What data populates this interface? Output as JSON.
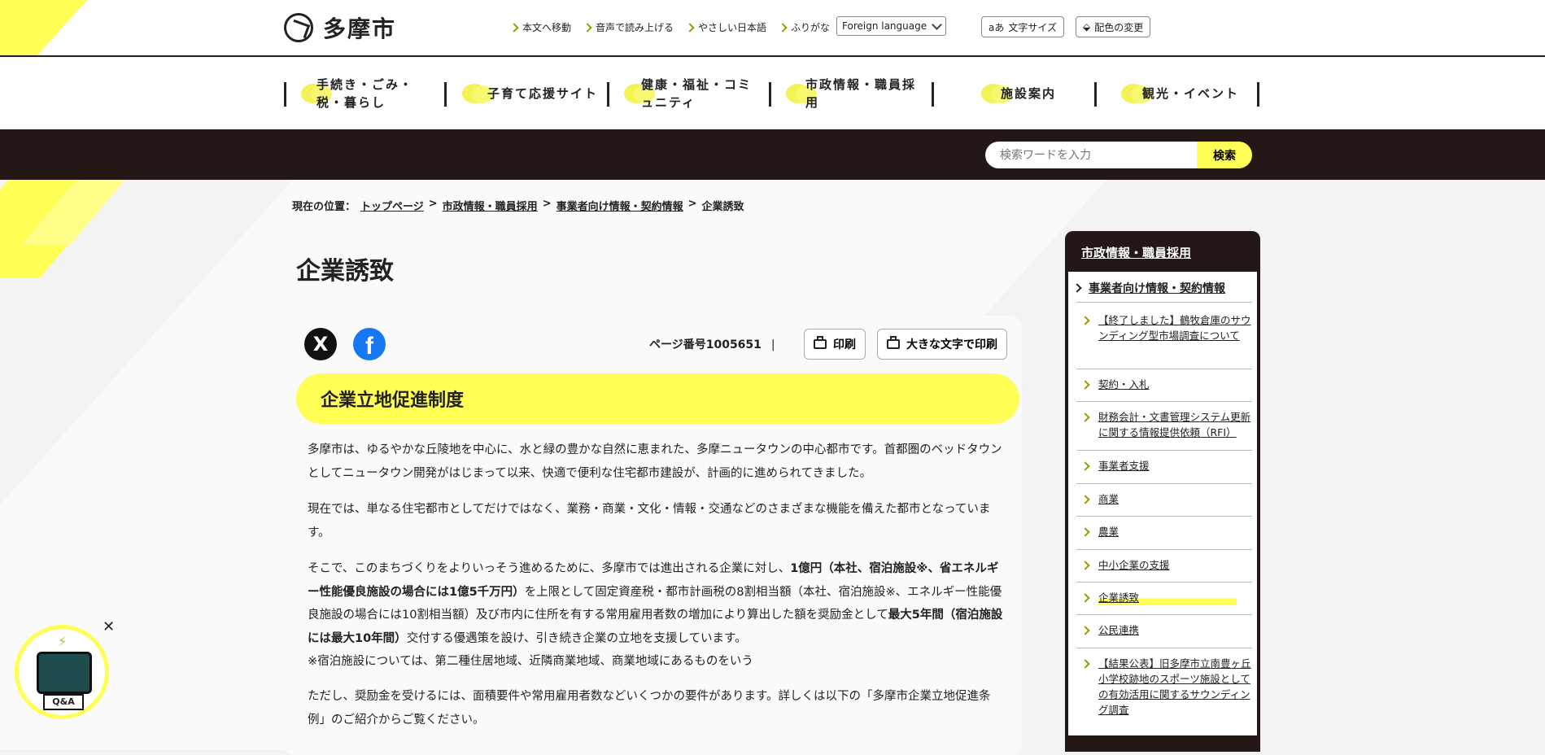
{
  "header": {
    "logo_text": "多摩市",
    "util_links": [
      "本文へ移動",
      "音声で読み上げる",
      "やさしい日本語",
      "ふりがな"
    ],
    "language_select": "Foreign language",
    "font_size_label": "文字サイズ",
    "font_size_icon_text": "aあ",
    "color_change_label": "配色の変更"
  },
  "gnav": {
    "items": [
      "手続き・ごみ・税・暮らし",
      "子育て応援サイト",
      "健康・福祉・コミュニティ",
      "市政情報・職員採用",
      "施設案内",
      "観光・イベント"
    ]
  },
  "search": {
    "placeholder": "検索ワードを入力",
    "button": "検索"
  },
  "breadcrumb": {
    "label": "現在の位置：",
    "links": [
      "トップページ",
      "市政情報・職員採用",
      "事業者向け情報・契約情報"
    ],
    "separator": ">",
    "current": "企業誘致"
  },
  "page": {
    "title": "企業誘致",
    "sns_x": "X",
    "sns_fb": "f",
    "page_number": "ページ番号1005651",
    "page_number_sep": "|",
    "print_label": "印刷",
    "print_large_label": "大きな文字で印刷",
    "section_heading": "企業立地促進制度",
    "para1": "多摩市は、ゆるやかな丘陵地を中心に、水と緑の豊かな自然に恵まれた、多摩ニュータウンの中心都市です。首都圏のベッドタウンとしてニュータウン開発がはじまって以来、快適で便利な住宅都市建設が、計画的に進められてきました。",
    "para2": "現在では、単なる住宅都市としてだけではなく、業務・商業・文化・情報・交通などのさまざまな機能を備えた都市となっています。",
    "para3": {
      "t1": "そこで、このまちづくりをよりいっそう進めるために、多摩市では進出される企業に対し、",
      "b1": "1億円（本社、宿泊施設※、省エネルギー性能優良施設の場合には1億5千万円）",
      "t2": "を上限として固定資産税・都市計画税の8割相当額（本社、宿泊施設※、エネルギー性能優良施設の場合には10割相当額）及び市内に住所を有する常用雇用者数の増加により算出した額を奨励金として",
      "b2": "最大5年間（宿泊施設には最大10年間）",
      "t3": "交付する優遇策を設け、引き続き企業の立地を支援しています。",
      "note": "※宿泊施設については、第二種住居地域、近隣商業地域、商業地域にあるものをいう"
    },
    "para4": "ただし、奨励金を受けるには、面積要件や常用雇用者数などいくつかの要件があります。詳しくは以下の「多摩市企業立地促進条例」のご紹介からご覧ください。"
  },
  "sidebar": {
    "title": "市政情報・職員採用",
    "category": "事業者向け情報・契約情報",
    "items": [
      "【終了しました】鶴牧倉庫のサウンディング型市場調査について",
      "契約・入札",
      "財務会計・文書管理システム更新に関する情報提供依頼（RFI）",
      "事業者支援",
      "商業",
      "農業",
      "中小企業の支援",
      "企業誘致",
      "公民連携",
      "【結果公表】旧多摩市立南豊ヶ丘小学校跡地のスポーツ施設としての有効活用に関するサウンディング調査"
    ],
    "current_index": 7
  },
  "qa_bot": {
    "label": "Q&A",
    "close": "✕"
  }
}
